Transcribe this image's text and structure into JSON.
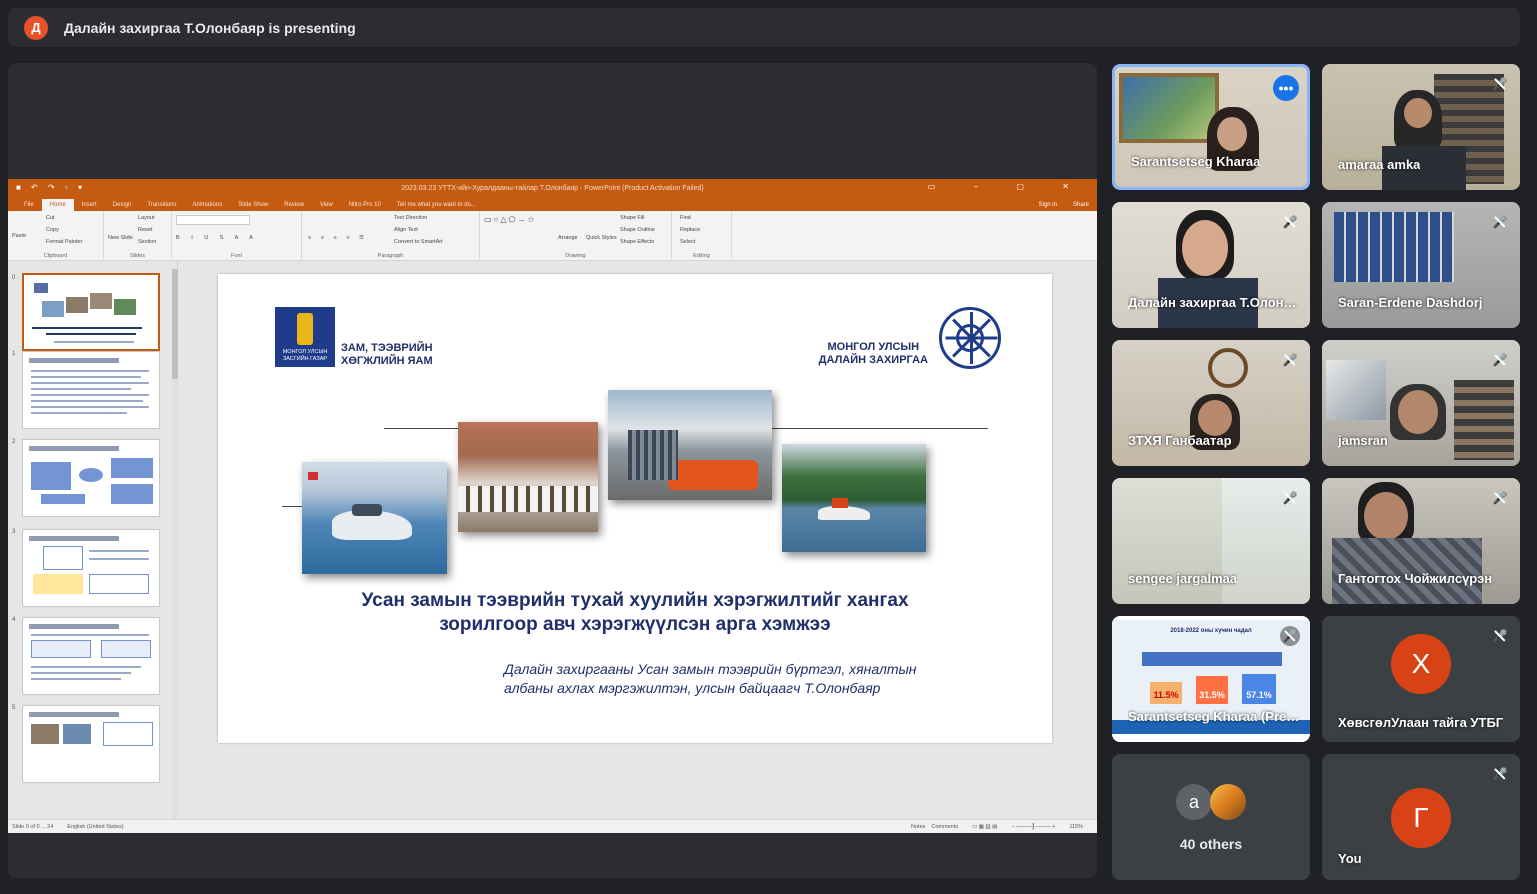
{
  "banner": {
    "avatar_letter": "Д",
    "text": "Далайн захиргаа Т.Олонбаяр is presenting"
  },
  "ppt": {
    "window_title": "2023.03.23 УТТХ-ийн-Хуралдааны-тайлар Т.Олонбаяр - PowerPoint (Product Activation Failed)",
    "tabs": [
      "File",
      "Home",
      "Insert",
      "Design",
      "Transitions",
      "Animations",
      "Slide Show",
      "Review",
      "View",
      "Nitro Pro 10",
      "Tell me what you want to do..."
    ],
    "sign_in": "Sign in",
    "share": "Share",
    "ribbon": {
      "paste": "Paste",
      "cut": "Cut",
      "copy": "Copy",
      "format_painter": "Format Painter",
      "clipboard": "Clipboard",
      "new_slide": "New Slide",
      "layout": "Layout",
      "reset": "Reset",
      "section": "Section",
      "slides": "Slides",
      "font": "Font",
      "paragraph": "Paragraph",
      "text_direction": "Text Direction",
      "align_text": "Align Text",
      "convert": "Convert to SmartArt",
      "arrange": "Arrange",
      "quick_styles": "Quick Styles",
      "shape_fill": "Shape Fill",
      "shape_outline": "Shape Outline",
      "shape_effects": "Shape Effects",
      "drawing": "Drawing",
      "find": "Find",
      "replace": "Replace",
      "select": "Select",
      "editing": "Editing"
    },
    "thumb_numbers": [
      "0",
      "1",
      "2",
      "3",
      "4",
      "5"
    ],
    "status": {
      "slide": "Slide 0 of 0 ... 24",
      "language": "English (United States)",
      "notes": "Notes",
      "comments": "Comments",
      "zoom": "115%"
    }
  },
  "slide": {
    "logo_left_caption": "МОНГОЛ УЛСЫН ЗАСГИЙН ГАЗАР",
    "ministry_line1": "ЗАМ, ТЭЭВРИЙН",
    "ministry_line2": "ХӨГЖЛИЙН ЯАМ",
    "admin_line1": "МОНГОЛ УЛСЫН",
    "admin_line2": "ДАЛАЙН ЗАХИРГАА",
    "title_line1": "Усан замын тээврийн тухай хуулийн хэрэгжилтийг хангах",
    "title_line2": "зорилгоор авч хэрэгжүүлсэн арга хэмжээ",
    "subtitle_line1": "Далайн захиргааны Усан замын тээврийн бүртгэл, хяналтын",
    "subtitle_line2": "албаны ахлах мэргэжилтэн, улсын байцаагч Т.Олонбаяр"
  },
  "participants": [
    {
      "name": "Sarantsetseg Kharaa"
    },
    {
      "name": "amaraa amka"
    },
    {
      "name": "Далайн захиргаа Т.Олонбаяр"
    },
    {
      "name": "Saran-Erdene Dashdorj"
    },
    {
      "name": "ЗТХЯ Ганбаатар"
    },
    {
      "name": "jamsran"
    },
    {
      "name": "sengee jargalmaa"
    },
    {
      "name": "Гантогтох Чойжилсүрэн"
    },
    {
      "name": "Sarantsetseg Kharaa (Presentation)"
    },
    {
      "name": "ХөвсгөлУлаан тайга УТБГ",
      "letter": "Х"
    },
    {
      "name": "40 others",
      "letter": "а"
    },
    {
      "name": "You",
      "letter": "Г"
    }
  ],
  "pres_preview": {
    "v1": "11.5%",
    "v2": "31.5%",
    "v3": "57.1%",
    "title": "2018-2022 оны хүчин чадал"
  },
  "colors": {
    "accent": "#8ab4f8",
    "tile_bg": "#3c4043",
    "ppt_orange": "#c55a11",
    "avatar_orange": "#d84315"
  }
}
